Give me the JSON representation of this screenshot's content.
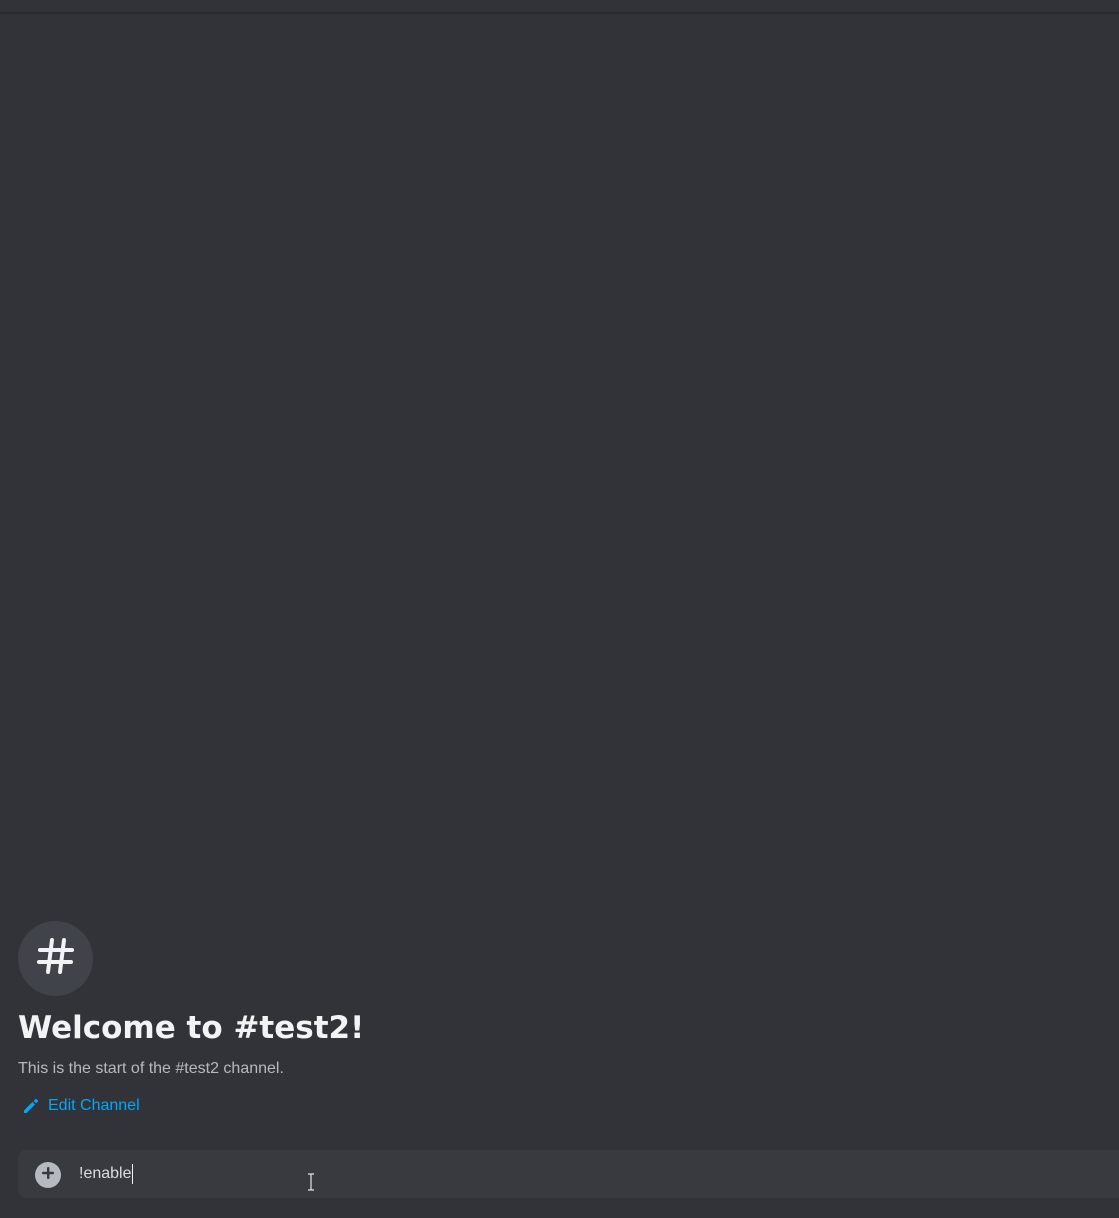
{
  "channel": {
    "icon": "hash-icon",
    "welcome_title": "Welcome to #test2!",
    "welcome_subtitle": "This is the start of the #test2 channel.",
    "edit_channel_label": "Edit Channel"
  },
  "composer": {
    "attach_icon": "plus-circle-icon",
    "input_value": "!enable"
  },
  "colors": {
    "background": "#313338",
    "icon_circle": "#41434a",
    "title": "#f2f3f5",
    "subtitle": "#b5bac1",
    "link": "#00a8fc",
    "composer_bg": "#383a40"
  }
}
